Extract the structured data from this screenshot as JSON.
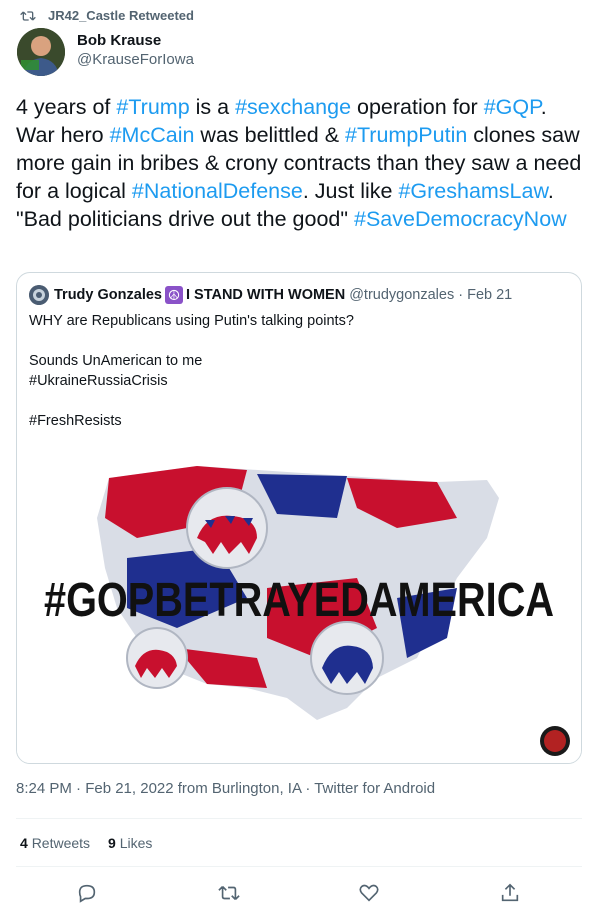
{
  "retweeter": {
    "text": "JR42_Castle Retweeted"
  },
  "author": {
    "name": "Bob Krause",
    "handle": "@KrauseForIowa"
  },
  "tweet": {
    "p1": "4 years of ",
    "t1": "#Trump",
    "p2": " is a ",
    "t2": "#sexchange",
    "p3": " operation for ",
    "t3": "#GQP",
    "p4": ". War hero ",
    "t4": "#McCain",
    "p5": " was belittled & ",
    "t5": "#TrumpPutin",
    "p6": " clones saw more gain in bribes & crony contracts than they saw a need for a logical ",
    "t6": "#NationalDefense",
    "p7": ". Just like ",
    "t7": "#GreshamsLaw",
    "p8": ". \"Bad politicians drive out the good\" ",
    "t8": "#SaveDemocracyNow"
  },
  "quote": {
    "name": "Trudy Gonzales",
    "name_suffix": "I STAND WITH WOMEN",
    "emoji": "☮",
    "handle_date": "@trudygonzales · Feb 21",
    "lines": [
      "WHY are Republicans using Putin's talking points?",
      "",
      "Sounds UnAmerican to me",
      "#UkraineRussiaCrisis",
      "",
      "#FreshResists"
    ],
    "image_text": "#GOPBETRAYEDAMERICA"
  },
  "meta": "8:24 PM · Feb 21, 2022 from Burlington, IA · Twitter for Android",
  "stats": {
    "retweets_count": "4",
    "retweets_label": "Retweets",
    "likes_count": "9",
    "likes_label": "Likes"
  },
  "icons": {
    "reply": "reply-icon",
    "retweet": "retweet-icon",
    "like": "heart-icon",
    "share": "share-icon"
  },
  "colors": {
    "link": "#1d9bf0",
    "muted": "#536471",
    "text": "#0f1419"
  }
}
